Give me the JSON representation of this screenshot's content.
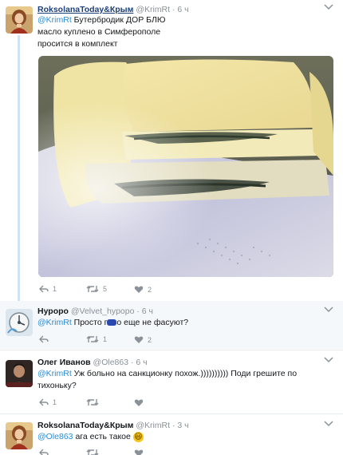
{
  "tweets": [
    {
      "name": "RoksolanaToday&Крым",
      "handle": "@KrimRt",
      "time": "· 6 ч",
      "reply_to": "@KrimRt",
      "text_line1": " Бутербродик ДОР БЛЮ",
      "text_line2": "масло куплено в Симферополе",
      "text_line3": "просится в комплект",
      "reply_count": "1",
      "retweet_count": "5",
      "like_count": "2"
    },
    {
      "name": "Нуроро",
      "handle": "@Velvet_hypopo",
      "time": "· 6 ч",
      "reply_to": "@KrimRt",
      "text_before": " Просто г",
      "text_after": "о еще не фасуют?",
      "reply_count": "",
      "retweet_count": "1",
      "like_count": "2"
    },
    {
      "name": "Олег Иванов",
      "handle": "@Ole863",
      "time": "· 6 ч",
      "reply_to": "@KrimRt",
      "text_line1": " Уж больно на санкционку похож.)))))))))) Поди грешите по",
      "text_line2": "тихоньку?",
      "reply_count": "1",
      "retweet_count": "",
      "like_count": ""
    },
    {
      "name": "RoksolanaToday&Крым",
      "handle": "@KrimRt",
      "time": "· 3 ч",
      "reply_to": "@Ole863",
      "text": " ага есть такое",
      "emoji": "😃"
    }
  ],
  "icons": [
    "reply-icon",
    "retweet-icon",
    "like-icon",
    "chevron-down-icon"
  ],
  "colors": {
    "link": "#2a8bd6",
    "name_link": "#1b3f78",
    "thread_line": "#cfe3f2",
    "meta": "#8a9199"
  }
}
